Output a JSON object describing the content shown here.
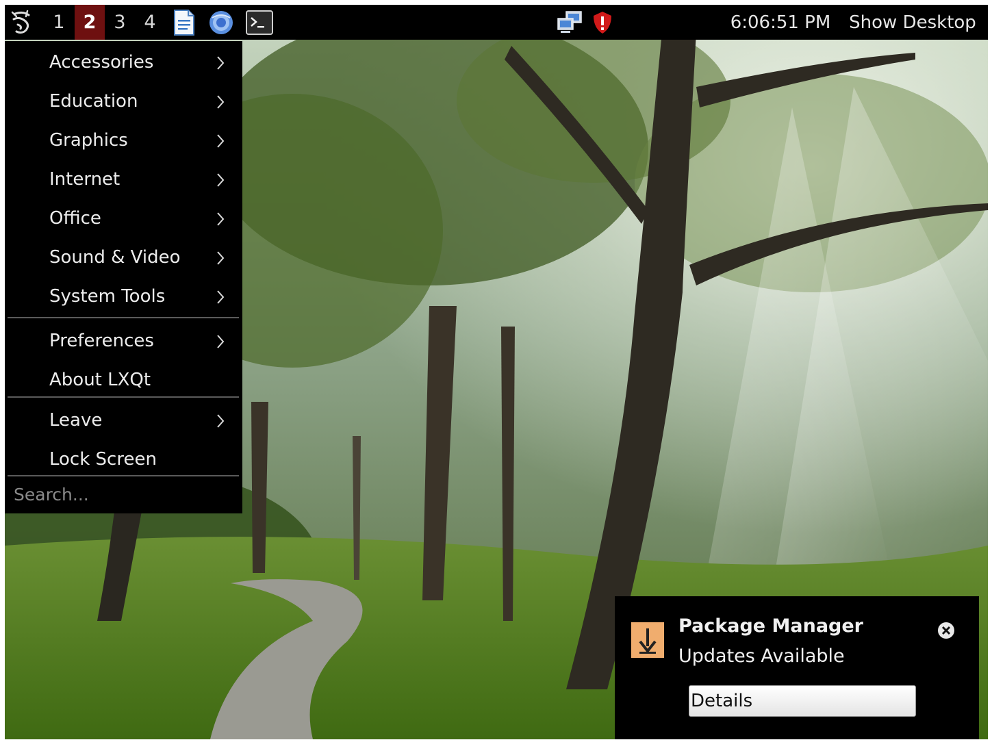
{
  "panel": {
    "desktops": [
      {
        "label": "1",
        "active": false
      },
      {
        "label": "2",
        "active": true
      },
      {
        "label": "3",
        "active": false
      },
      {
        "label": "4",
        "active": false
      }
    ],
    "quicklaunch_icons": [
      "document-icon",
      "web-browser-icon",
      "terminal-icon"
    ],
    "tray_icons": [
      "network-icon",
      "security-shield-icon"
    ],
    "clock": "6:06:51 PM",
    "show_desktop_label": "Show Desktop",
    "active_desktop_color": "#6e1010"
  },
  "menu": {
    "items": [
      {
        "label": "Accessories",
        "submenu": true
      },
      {
        "label": "Education",
        "submenu": true
      },
      {
        "label": "Graphics",
        "submenu": true
      },
      {
        "label": "Internet",
        "submenu": true
      },
      {
        "label": "Office",
        "submenu": true
      },
      {
        "label": "Sound & Video",
        "submenu": true
      },
      {
        "label": "System Tools",
        "submenu": true
      },
      {
        "label": "Preferences",
        "submenu": true
      },
      {
        "label": "About LXQt",
        "submenu": false
      },
      {
        "label": "Leave",
        "submenu": true
      },
      {
        "label": "Lock Screen",
        "submenu": false
      }
    ],
    "search_placeholder": "Search..."
  },
  "notification": {
    "title": "Package Manager",
    "body": "Updates Available",
    "button_label": "Details",
    "icon": "download-arrow-icon",
    "icon_color": "#f0ad6e"
  }
}
